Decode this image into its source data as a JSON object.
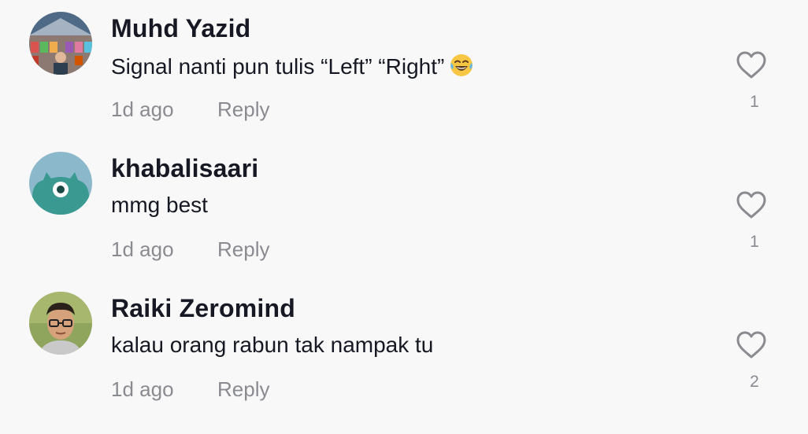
{
  "comments": [
    {
      "username": "Muhd Yazid",
      "text": "Signal nanti pun tulis “Left” “Right”",
      "emoji": "😂",
      "time": "1d ago",
      "reply_label": "Reply",
      "likes": "1",
      "avatar_icon": "photo-avatar-building"
    },
    {
      "username": "khabalisaari",
      "text": "mmg best",
      "time": "1d ago",
      "reply_label": "Reply",
      "likes": "1",
      "avatar_icon": "default-avatar-monster"
    },
    {
      "username": "Raiki Zeromind",
      "text": "kalau orang rabun tak nampak tu",
      "time": "1d ago",
      "reply_label": "Reply",
      "likes": "2",
      "avatar_icon": "photo-avatar-person"
    }
  ],
  "like_icon": "heart-outline-icon",
  "colors": {
    "background": "#f8f8f8",
    "text_primary": "#161823",
    "text_secondary": "#8a8b91",
    "icon_gray": "#8a8b91"
  }
}
